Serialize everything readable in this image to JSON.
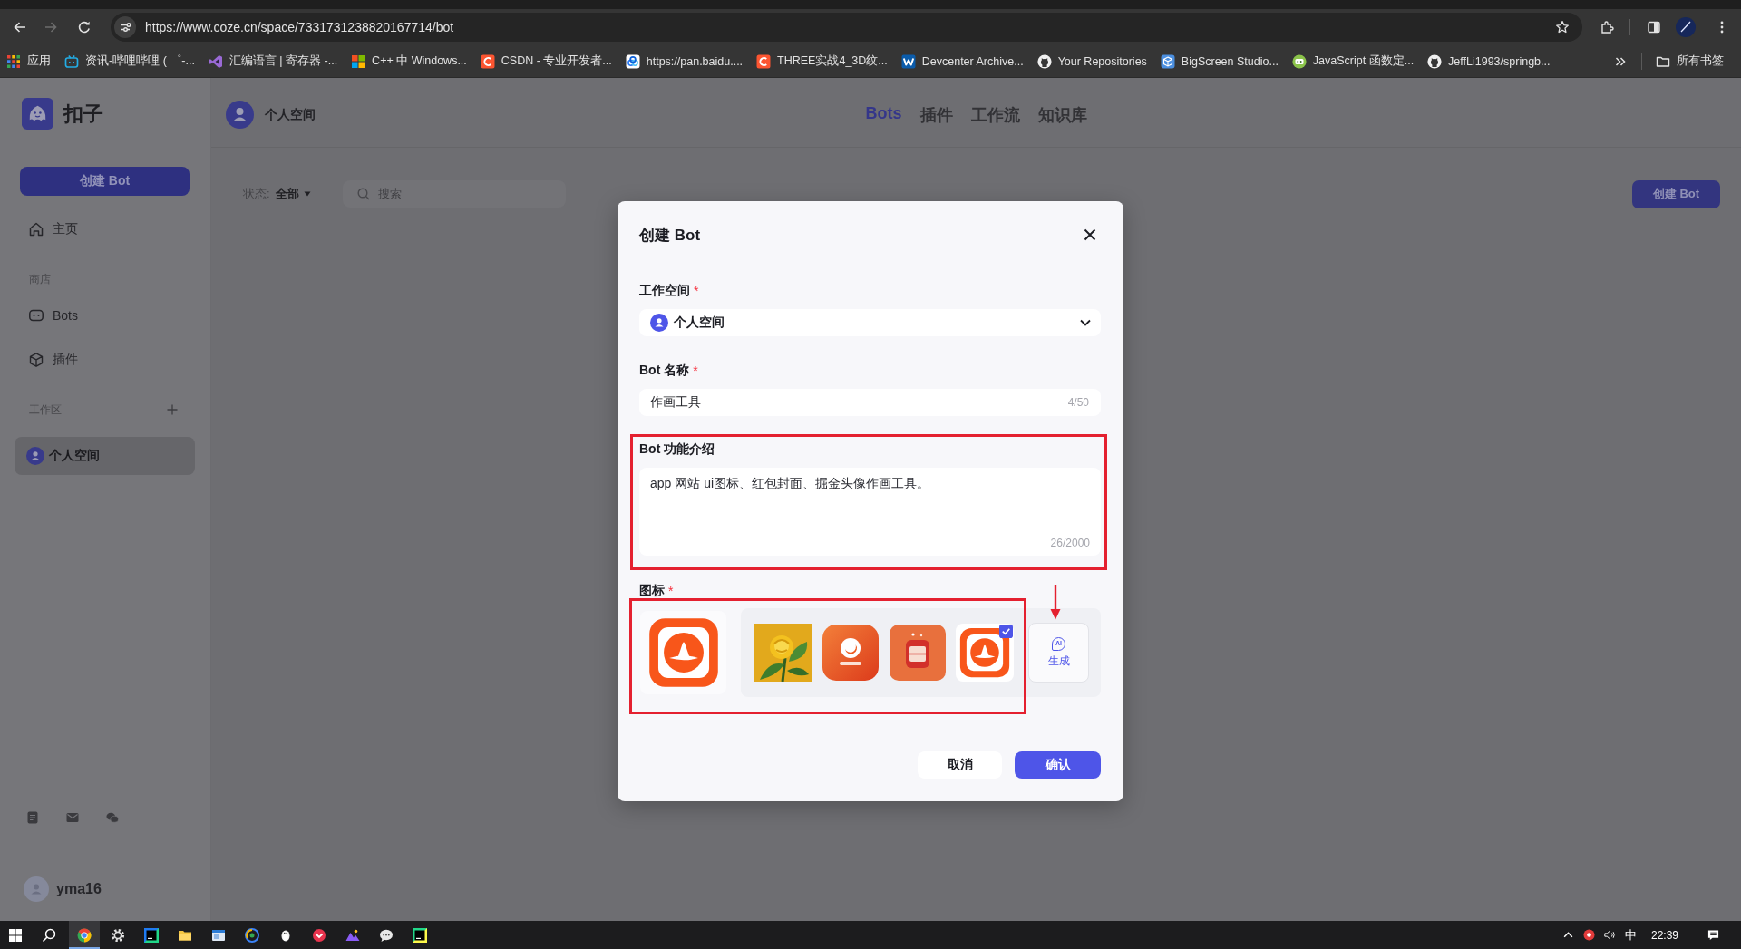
{
  "browser": {
    "url": "https://www.coze.cn/space/7331731238820167714/bot",
    "can_go_forward": false,
    "bookmarks": [
      {
        "kind": "grid",
        "label": "应用"
      },
      {
        "kind": "tv",
        "label": "资讯-哔哩哔哩 ( ゜-..."
      },
      {
        "kind": "ribbon",
        "label": "汇编语言 | 寄存器 -..."
      },
      {
        "kind": "tiles",
        "label": "C++ 中 Windows..."
      },
      {
        "kind": "c-tile",
        "label": "CSDN - 专业开发者..."
      },
      {
        "kind": "cloud",
        "label": "https://pan.baidu...."
      },
      {
        "kind": "c-tile",
        "label": "THREE实战4_3D纹..."
      },
      {
        "kind": "w-tile",
        "label": "Devcenter Archive..."
      },
      {
        "kind": "cat",
        "label": "Your Repositories"
      },
      {
        "kind": "cube",
        "label": "BigScreen Studio..."
      },
      {
        "kind": "chat",
        "label": "JavaScript 函数定..."
      },
      {
        "kind": "cat",
        "label": "JeffLi1993/springb..."
      }
    ],
    "all_bookmarks": "所有书签"
  },
  "sidebar": {
    "brand": "扣子",
    "create_button": "创建 Bot",
    "items": [
      {
        "kind": "home",
        "label": "主页",
        "selected": false
      },
      {
        "kind": "heading",
        "label": "商店",
        "addable": false
      },
      {
        "kind": "robot",
        "label": "Bots",
        "selected": false
      },
      {
        "kind": "cube",
        "label": "插件",
        "selected": false
      },
      {
        "kind": "heading",
        "label": "工作区",
        "addable": true
      },
      {
        "kind": "space",
        "label": "个人空间",
        "selected": true
      }
    ],
    "user": "yma16"
  },
  "header": {
    "space": "个人空间",
    "tabs": [
      {
        "label": "Bots",
        "selected": true
      },
      {
        "label": "插件",
        "selected": false
      },
      {
        "label": "工作流",
        "selected": false
      },
      {
        "label": "知识库",
        "selected": false
      }
    ]
  },
  "toolbar": {
    "status_label": "状态:",
    "status_value": "全部",
    "search_placeholder": "搜索",
    "create_button": "创建 Bot"
  },
  "dialog": {
    "title": "创建 Bot",
    "fields": [
      {
        "kind": "select",
        "label": "工作空间",
        "required_mark": "*",
        "value": "个人空间",
        "highlighted": false
      },
      {
        "kind": "input",
        "label": "Bot 名称",
        "required_mark": "*",
        "value": "作画工具",
        "count": "4/50",
        "highlighted": false
      },
      {
        "kind": "textarea",
        "label": "Bot 功能介绍",
        "value": "app 网站 ui图标、红包封面、掘金头像作画工具。",
        "count": "26/2000",
        "highlighted": true
      },
      {
        "kind": "icon-picker",
        "label": "图标",
        "required_mark": "*",
        "highlighted": true,
        "preview": {
          "kind": "logo"
        },
        "options": [
          {
            "kind": "photo",
            "selected": false
          },
          {
            "kind": "badge",
            "selected": false
          },
          {
            "kind": "calendar",
            "selected": false
          },
          {
            "kind": "logo",
            "selected": true
          }
        ],
        "generate": {
          "badge": "AI",
          "label": "生成",
          "arrow": true
        }
      }
    ],
    "cancel": "取消",
    "confirm": "确认"
  },
  "taskbar": {
    "apps": [
      {
        "kind": "browser",
        "active": true
      },
      {
        "kind": "gear",
        "active": false
      },
      {
        "kind": "ide",
        "active": false
      },
      {
        "kind": "folder",
        "active": false
      },
      {
        "kind": "window",
        "active": false
      },
      {
        "kind": "orb",
        "active": false
      },
      {
        "kind": "penguin",
        "active": false
      },
      {
        "kind": "red-circle",
        "active": false
      },
      {
        "kind": "mountains",
        "active": false
      },
      {
        "kind": "chat",
        "active": false
      },
      {
        "kind": "dark-ide",
        "active": false
      }
    ],
    "ime": "中",
    "time": "22:39"
  }
}
